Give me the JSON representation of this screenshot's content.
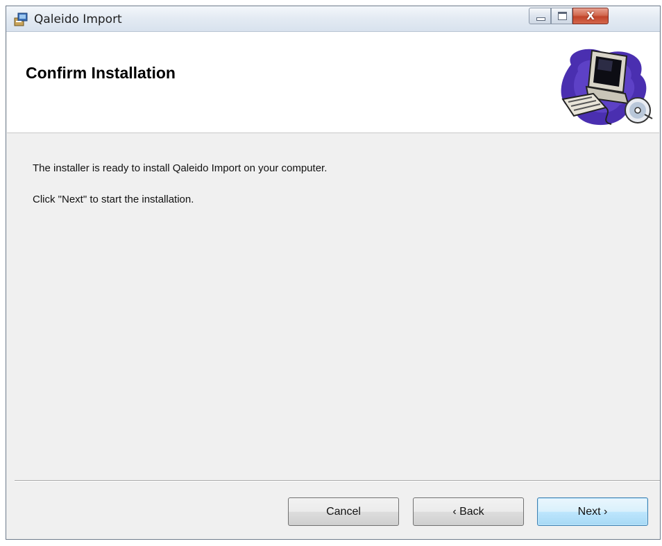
{
  "window": {
    "title": "Qaleido Import",
    "close_label": "X"
  },
  "banner": {
    "title": "Confirm Installation",
    "icon": "computer-with-cd-icon"
  },
  "content": {
    "line1": "The installer is ready to install Qaleido Import on your computer.",
    "line2": "Click \"Next\" to start the installation."
  },
  "buttons": {
    "cancel": "Cancel",
    "back": "‹ Back",
    "next": "Next ›"
  },
  "colors": {
    "dialog_background": "#f0f0f0",
    "banner_background": "#ffffff",
    "default_button_border": "#3c7fb1",
    "close_button": "#c1442a"
  }
}
